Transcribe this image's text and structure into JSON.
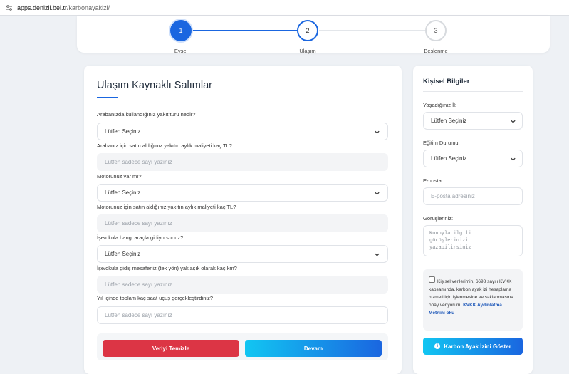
{
  "browser": {
    "url_host": "apps.denizli.bel.tr",
    "url_path": "/karbonayakizi/",
    "site_icon": "site-info-icon"
  },
  "stepper": {
    "steps": [
      {
        "number": "1",
        "label": "Evsel"
      },
      {
        "number": "2",
        "label": "Ulaşım"
      },
      {
        "number": "3",
        "label": "Beslenme"
      }
    ]
  },
  "form": {
    "title": "Ulaşım Kaynaklı Salımlar",
    "q1": "Arabanızda kullandığınız yakıt türü nedir?",
    "q1_value": "Lütfen Seçiniz",
    "q2": "Arabanız için satın aldığınız yakıtın aylık maliyeti kaç TL?",
    "q2_placeholder": "Lütfen sadece sayı yazınız",
    "q3": "Motorunuz var mı?",
    "q3_value": "Lütfen Seçiniz",
    "q4": "Motorunuz için satın aldığınız yakıtın aylık maliyeti kaç TL?",
    "q4_placeholder": "Lütfen sadece sayı yazınız",
    "q5": "İşe/okula hangi araçla gidiyorsunuz?",
    "q5_value": "Lütfen Seçiniz",
    "q6": "İşe/okula gidiş mesafeniz (tek yön) yaklaşık olarak kaç km?",
    "q6_placeholder": "Lütfen sadece sayı yazınız",
    "q7": "Yıl içinde toplam kaç saat uçuş gerçekleştirdiniz?",
    "q7_placeholder": "Lütfen sadece sayı yazınız",
    "clear_label": "Veriyi Temizle",
    "next_label": "Devam"
  },
  "personal": {
    "title": "Kişisel Bilgiler",
    "city_label": "Yaşadığınız İl:",
    "city_value": "Lütfen Seçiniz",
    "education_label": "Eğitim Durumu:",
    "education_value": "Lütfen Seçiniz",
    "email_label": "E-posta:",
    "email_placeholder": "E-posta adresiniz",
    "opinion_label": "Görüşleriniz:",
    "opinion_placeholder": "Konuyla ilgili\ngörüşlerinizi\nyazabilirsiniz",
    "consent_text": "Kişisel verilerimin, 6698 sayılı KVKK kapsamında, karbon ayak izi hesaplama hizmeti için işlenmesine ve saklanmasına onay veriyorum.",
    "consent_link": "KVKK Aydınlatma Metnini oku",
    "show_label": "Karbon Ayak İzini Göster"
  },
  "colors": {
    "primary": "#1a66e0",
    "danger": "#dc3545",
    "gradient_start": "#12c6f2"
  }
}
